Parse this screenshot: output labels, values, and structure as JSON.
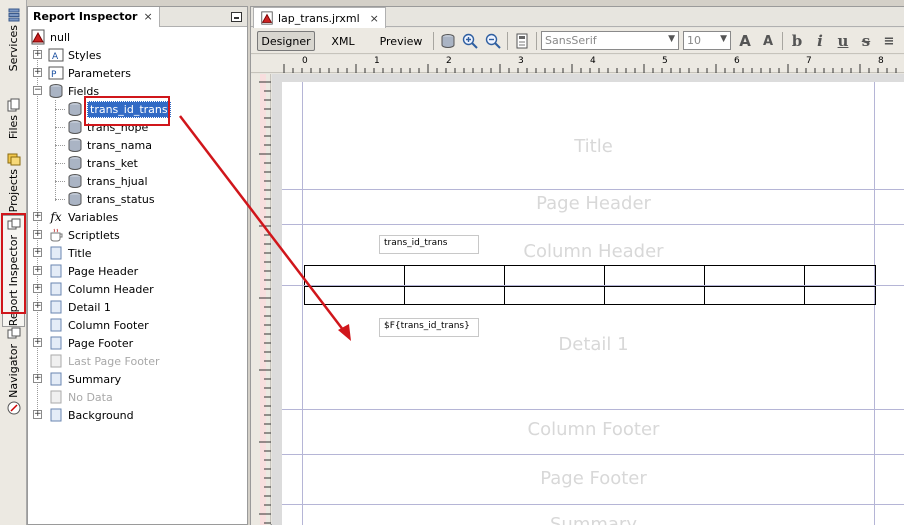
{
  "side_tabs": [
    {
      "label": "Services",
      "icon": "services-icon"
    },
    {
      "label": "Files",
      "icon": "files-icon"
    },
    {
      "label": "Projects",
      "icon": "projects-icon"
    },
    {
      "label": "Report Inspector",
      "icon": "report-inspector-icon"
    },
    {
      "label": "Navigator",
      "icon": "navigator-icon"
    }
  ],
  "inspector": {
    "title": "Report Inspector",
    "close": "×",
    "tree": {
      "root": "null",
      "styles": "Styles",
      "parameters": "Parameters",
      "fields": "Fields",
      "field_items": [
        "trans_id_trans",
        "trans_nope",
        "trans_nama",
        "trans_ket",
        "trans_hjual",
        "trans_status"
      ],
      "variables": "Variables",
      "scriptlets": "Scriptlets",
      "title": "Title",
      "page_header": "Page Header",
      "column_header": "Column Header",
      "detail_1": "Detail 1",
      "column_footer": "Column Footer",
      "page_footer": "Page Footer",
      "last_page_footer": "Last Page Footer",
      "summary": "Summary",
      "no_data": "No Data",
      "background": "Background"
    }
  },
  "editor": {
    "file_tab": "lap_trans.jrxml",
    "close": "×",
    "views": {
      "designer": "Designer",
      "xml": "XML",
      "preview": "Preview"
    },
    "font_name": "SansSerif",
    "font_size": "10",
    "ruler_marks": [
      "0",
      "1",
      "2",
      "3",
      "4",
      "5",
      "6",
      "7",
      "8"
    ]
  },
  "bands": {
    "title": "Title",
    "page_header": "Page Header",
    "column_header": "Column Header",
    "detail_1": "Detail 1",
    "column_footer": "Column Footer",
    "page_footer": "Page Footer",
    "summary": "Summary"
  },
  "elements": {
    "static_text": "trans_id_trans",
    "text_field": "$F{trans_id_trans}"
  },
  "colors": {
    "highlight": "#d0161b",
    "selection": "#316ac5",
    "band_line": "#b5b5d6"
  }
}
